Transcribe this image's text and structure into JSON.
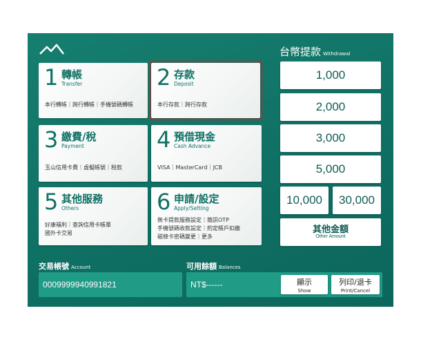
{
  "menu": [
    {
      "num": "1",
      "zh": "轉帳",
      "en": "Transfer",
      "sub": [
        "本行轉帳｜跨行轉帳｜手機號碼轉帳"
      ]
    },
    {
      "num": "2",
      "zh": "存款",
      "en": "Deposit",
      "sub": [
        "本行存款｜跨行存款"
      ]
    },
    {
      "num": "3",
      "zh": "繳費/稅",
      "en": "Payment",
      "sub": [
        "玉山信用卡費｜虛擬帳號｜稅款"
      ]
    },
    {
      "num": "4",
      "zh": "預借現金",
      "en": "Cash Advance",
      "sub": [
        "VISA｜MasterCard｜JCB"
      ]
    },
    {
      "num": "5",
      "zh": "其他服務",
      "en": "Others",
      "sub": [
        "好康福利｜查詢信用卡帳單",
        "國外卡交易"
      ]
    },
    {
      "num": "6",
      "zh": "申請/設定",
      "en": "Apply/Setting",
      "sub": [
        "無卡提款服務設定｜簡訊OTP",
        "手機號碼收款設定｜約定帳戶扣繳",
        "磁條卡密碼變更｜更多"
      ]
    }
  ],
  "withdrawal": {
    "title": "台幣提款",
    "title_en": "Withdrawal",
    "amounts": [
      "1,000",
      "2,000",
      "3,000",
      "5,000",
      "10,000",
      "30,000"
    ],
    "other_zh": "其他金額",
    "other_en": "Other Amount"
  },
  "account": {
    "label": "交易帳號",
    "label_en": "Account",
    "value": "0009999940991821"
  },
  "balance": {
    "label": "可用餘額",
    "label_en": "Balances",
    "value": "NT$------"
  },
  "buttons": {
    "show_zh": "顯示",
    "show_en": "Show",
    "print_zh": "列印/退卡",
    "print_en": "Print/Cancel"
  },
  "colors": {
    "background": "#0f7064",
    "accent": "#0f7064",
    "selected_outline": "#c0262b"
  }
}
